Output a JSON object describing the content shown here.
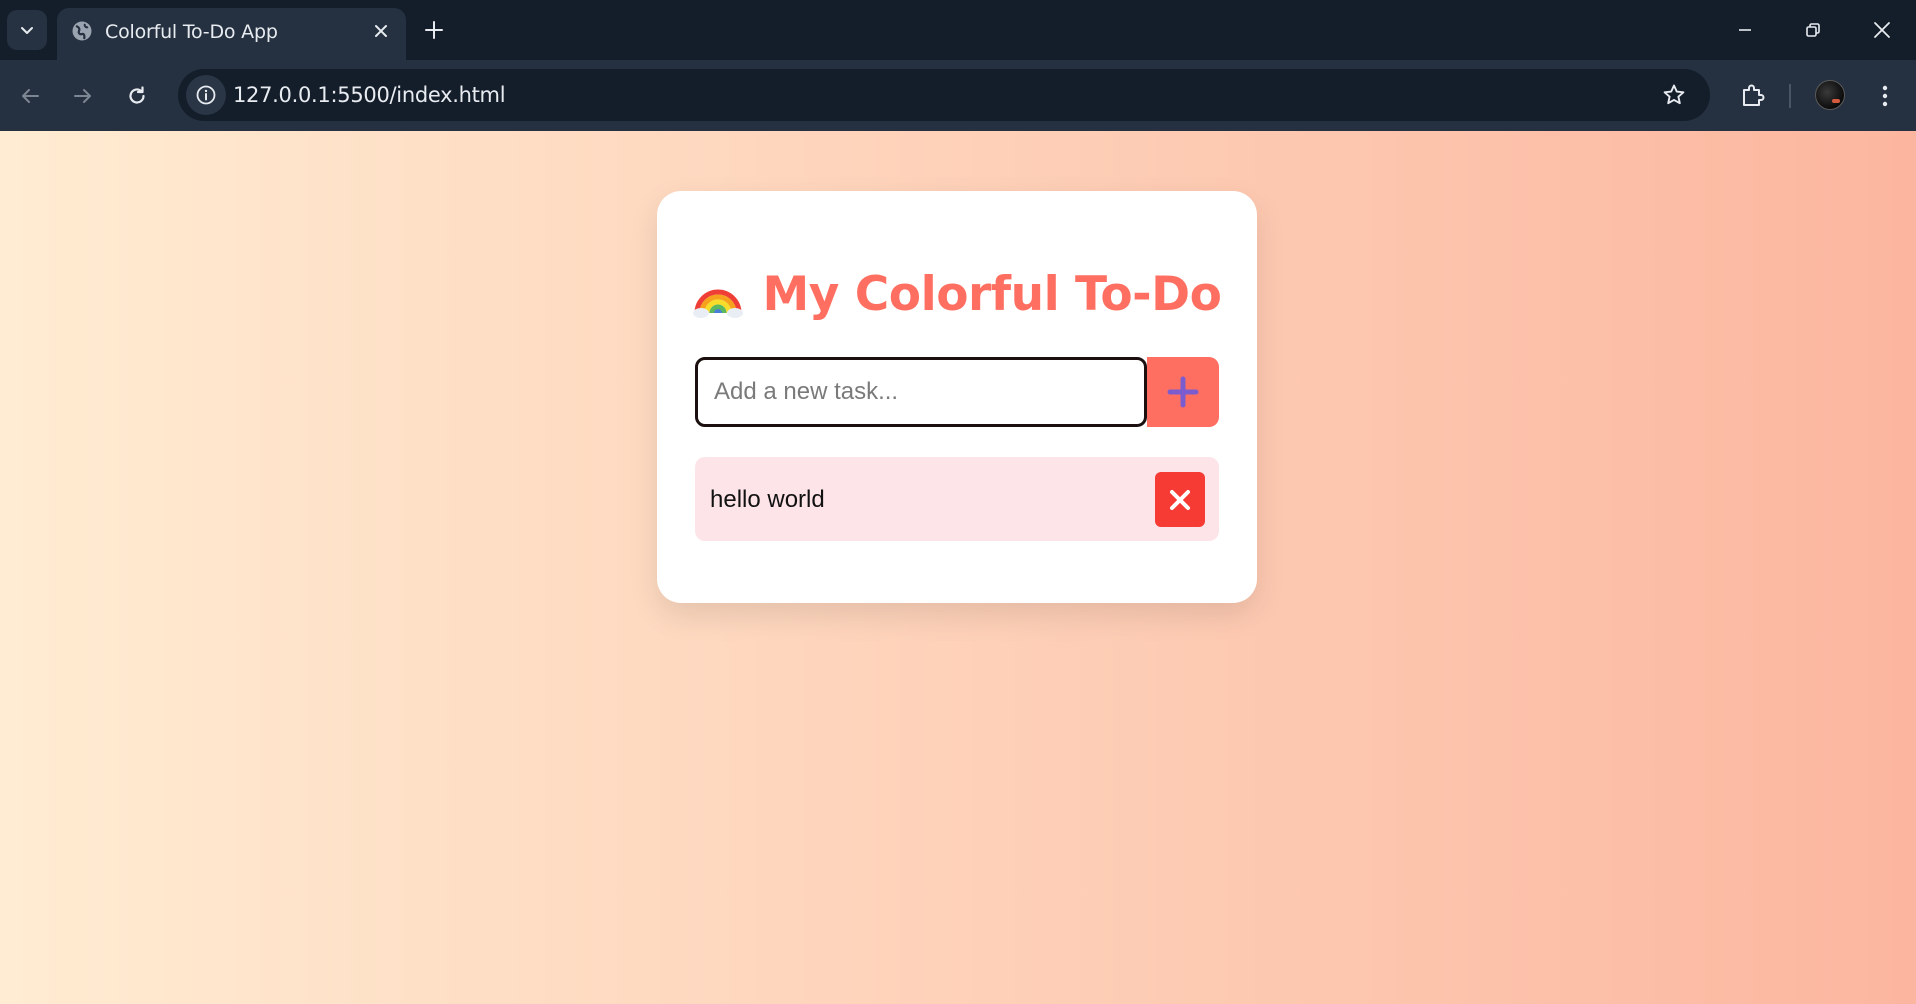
{
  "browser": {
    "tab_title": "Colorful To-Do App",
    "url": "127.0.0.1:5500/index.html"
  },
  "app": {
    "heading": "My Colorful To-Do",
    "input": {
      "placeholder": "Add a new task...",
      "value": ""
    },
    "tasks": [
      {
        "text": "hello world"
      }
    ],
    "colors": {
      "accent": "#ff6f61",
      "delete": "#f53b34",
      "task_bg": "#fde4e8",
      "plus_icon": "#7b5ccf",
      "gradient_start": "#ffecd2",
      "gradient_end": "#fcb69f"
    },
    "icons": {
      "heading": "rainbow-icon",
      "add": "plus-icon",
      "delete": "close-icon"
    }
  }
}
